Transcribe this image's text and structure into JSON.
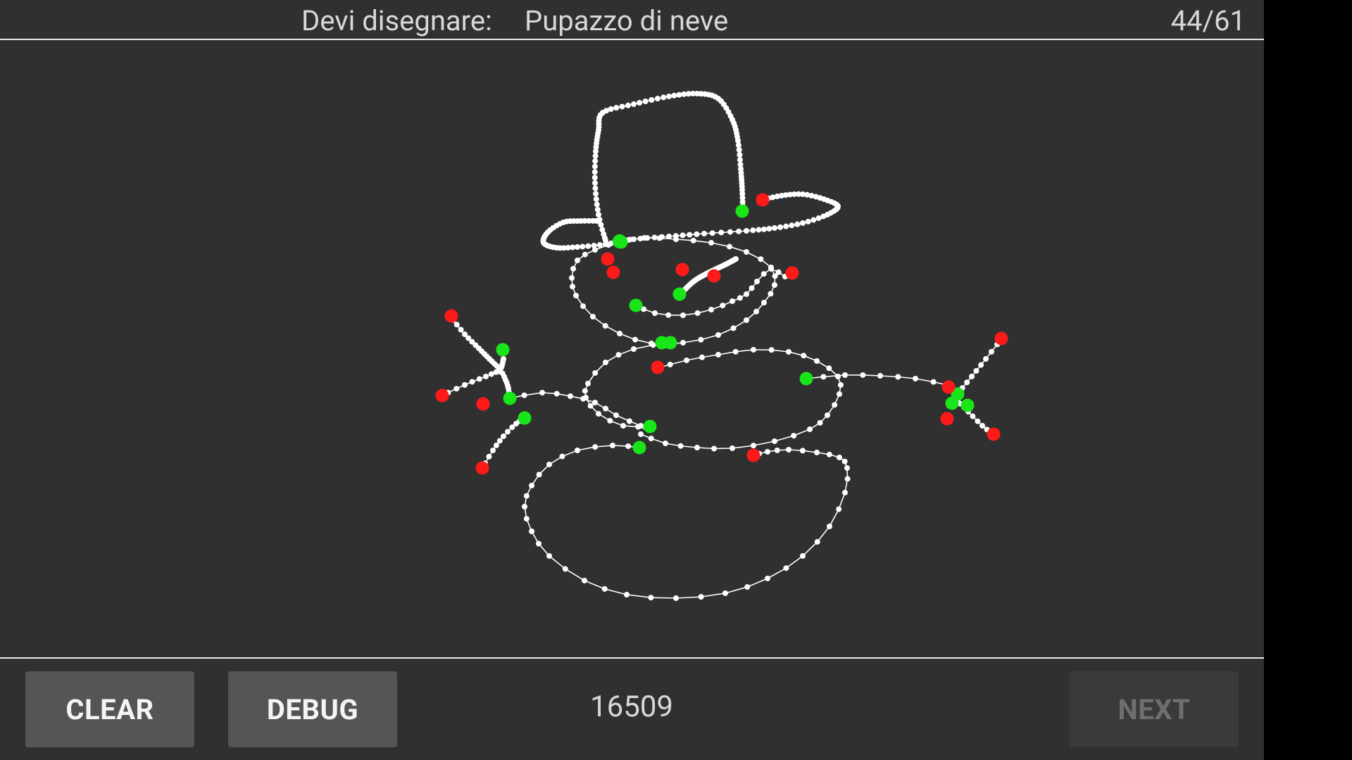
{
  "header": {
    "prompt_label": "Devi disegnare:",
    "prompt_word": "Pupazzo di neve",
    "progress": "44/61"
  },
  "footer": {
    "clear_label": "CLEAR",
    "debug_label": "DEBUG",
    "score": "16509",
    "next_label": "NEXT"
  },
  "colors": {
    "background": "#303030",
    "stroke": "#ffffff",
    "start_point": "#19e619",
    "end_point": "#ff1a1a"
  }
}
